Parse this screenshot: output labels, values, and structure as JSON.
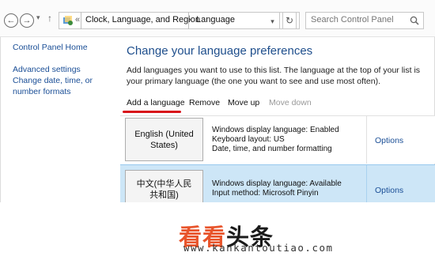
{
  "nav": {
    "back_glyph": "←",
    "forward_glyph": "→",
    "recent_glyph": "▾",
    "up_glyph": "↑",
    "breadcrumb": {
      "overflow": "«",
      "items": [
        "Clock, Language, and Region",
        "Language"
      ],
      "separator": "›"
    },
    "dropdown_glyph": "▾",
    "refresh_glyph": "↻",
    "search_placeholder": "Search Control Panel"
  },
  "sidebar": {
    "items": [
      {
        "label": "Control Panel Home"
      },
      {
        "label": "Advanced settings"
      },
      {
        "label": "Change date, time, or number formats"
      }
    ]
  },
  "main": {
    "title": "Change your language preferences",
    "description": "Add languages you want to use to this list. The language at the top of your list is your primary language (the one you want to see and use most often).",
    "toolbar": {
      "add": "Add a language",
      "remove": "Remove",
      "move_up": "Move up",
      "move_down": "Move down"
    },
    "languages": [
      {
        "name": "English (United States)",
        "details": [
          "Windows display language: Enabled",
          "Keyboard layout: US",
          "Date, time, and number formatting"
        ],
        "options": "Options"
      },
      {
        "name": "中文(中华人民共和国)",
        "details": [
          "Windows display language: Available",
          "Input method: Microsoft Pinyin"
        ],
        "options": "Options"
      }
    ]
  },
  "watermark": {
    "brand_part1": "看看",
    "brand_part2": "头条",
    "url": "www.kankantoutiao.com"
  },
  "colors": {
    "link": "#1a4e96",
    "title": "#1e4e8c",
    "selected_row": "#cde6f7",
    "underline_mark": "#d8101a",
    "watermark_orange": "#e8542b"
  }
}
